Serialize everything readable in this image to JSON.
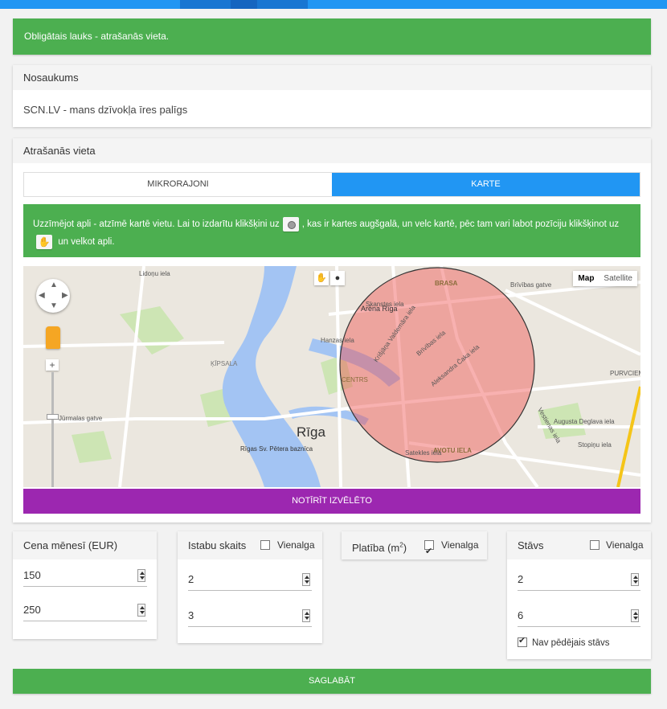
{
  "alert": {
    "text": "Obligātais lauks - atrašanās vieta."
  },
  "name_section": {
    "header": "Nosaukums",
    "value": "SCN.LV - mans dzīvokļa īres palīgs"
  },
  "location": {
    "header": "Atrašanās vieta",
    "tabs": [
      {
        "label": "MIKRORAJONI",
        "active": false
      },
      {
        "label": "KARTE",
        "active": true
      }
    ],
    "info_part1": "Uzzīmējot apli - atzīmē kartē vietu. Lai to izdarītu klikšķini uz",
    "info_part2": ", kas ir kartes augšgalā, un velc kartē, pēc tam vari labot pozīciju klikšķinot uz",
    "info_part3": "un velkot apli.",
    "map": {
      "type_buttons": [
        "Map",
        "Satellite"
      ],
      "active_type": "Map",
      "city_label": "Rīga",
      "labels": {
        "arena": "Arēna Rīga",
        "church": "Rīgas Sv. Pētera baznīca",
        "kipsala": "ĶĪPSALA",
        "brasa": "BRASA",
        "centrs": "CENTRS",
        "avotu": "AVOTU IELA",
        "purvciems": "PURVCIEM",
        "lidonu": "Lidoņu iela",
        "brivibas_gatve": "Brīvības gatve",
        "skanstes": "Skanstes iela",
        "jurmalas": "Jūrmalas gatve",
        "augusta": "Augusta Deglava iela",
        "vestienas": "Vestienas iela",
        "hanzas": "Hanzas iela",
        "brivibas": "Brīvības iela",
        "krisjana": "Krišjāņa Valdemāra iela",
        "aleksandra": "Aleksandra Čaka iela",
        "stopinu": "Stopiņu iela",
        "satekles": "Satekles iela"
      },
      "circle_color": "#ef5350"
    },
    "clear_button": "NOTĪRĪT IZVĒLĒTO"
  },
  "price": {
    "header": "Cena mēnesī (EUR)",
    "min": "150",
    "max": "250"
  },
  "rooms": {
    "header": "Istabu skaits",
    "any_label": "Vienalga",
    "any_checked": false,
    "min": "2",
    "max": "3"
  },
  "area": {
    "header_prefix": "Platība (m",
    "header_sup": "2",
    "header_suffix": ")",
    "any_label": "Vienalga",
    "any_checked": true
  },
  "floor": {
    "header": "Stāvs",
    "any_label": "Vienalga",
    "any_checked": false,
    "min": "2",
    "max": "6",
    "not_last_label": "Nav pēdējais stāvs",
    "not_last_checked": true
  },
  "save_button": "SAGLABĀT",
  "colors": {
    "primary": "#2196f3",
    "success": "#4caf50",
    "purple": "#9c27b0"
  }
}
